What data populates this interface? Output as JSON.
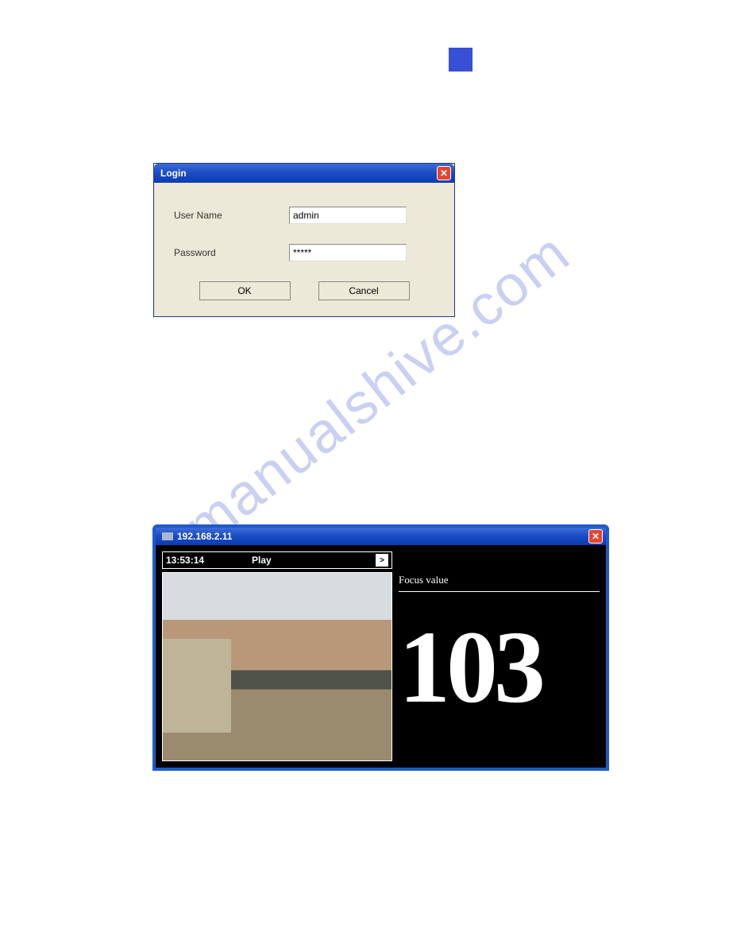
{
  "login": {
    "title": "Login",
    "username_label": "User Name",
    "username_value": "admin",
    "password_label": "Password",
    "password_value": "*****",
    "ok_label": "OK",
    "cancel_label": "Cancel"
  },
  "video": {
    "title": "192.168.2.11",
    "time": "13:53:14",
    "status": "Play",
    "focus_label": "Focus value",
    "focus_value": "103"
  },
  "watermark": "manualshive.com"
}
